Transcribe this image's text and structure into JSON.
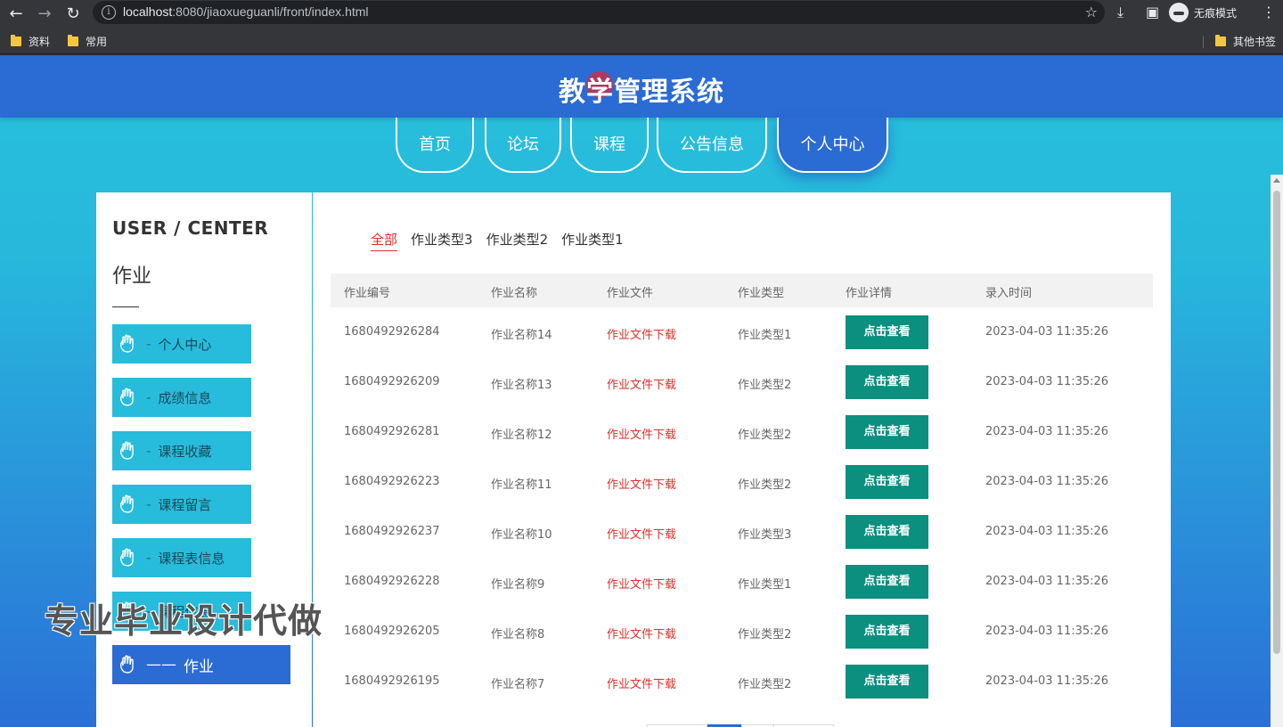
{
  "browser": {
    "url_host": "localhost",
    "url_rest": ":8080/jiaoxueguanli/front/index.html",
    "incognito_label": "无痕模式",
    "bookmarks": [
      "资料",
      "常用"
    ],
    "other_bookmarks": "其他书签"
  },
  "header": {
    "title": "教学管理系统"
  },
  "nav": [
    {
      "label": "首页"
    },
    {
      "label": "论坛"
    },
    {
      "label": "课程"
    },
    {
      "label": "公告信息"
    },
    {
      "label": "个人中心"
    }
  ],
  "sidebar": {
    "title": "USER / CENTER",
    "subtitle": "作业",
    "items": [
      {
        "label": "个人中心"
      },
      {
        "label": "成绩信息"
      },
      {
        "label": "课程收藏"
      },
      {
        "label": "课程留言"
      },
      {
        "label": "课程表信息"
      },
      {
        "label": "课程信息"
      },
      {
        "label": "作业"
      }
    ],
    "active_dash": "——",
    "dash": "-"
  },
  "watermark": "专业毕业设计代做",
  "tabs": [
    "全部",
    "作业类型3",
    "作业类型2",
    "作业类型1"
  ],
  "table": {
    "headers": [
      "作业编号",
      "作业名称",
      "作业文件",
      "作业类型",
      "作业详情",
      "录入时间"
    ],
    "rows": [
      {
        "id": "1680492926284",
        "name": "作业名称14",
        "file": "作业文件下载",
        "type": "作业类型1",
        "btn": "点击查看",
        "time": "2023-04-03 11:35:26"
      },
      {
        "id": "1680492926209",
        "name": "作业名称13",
        "file": "作业文件下载",
        "type": "作业类型2",
        "btn": "点击查看",
        "time": "2023-04-03 11:35:26"
      },
      {
        "id": "1680492926281",
        "name": "作业名称12",
        "file": "作业文件下载",
        "type": "作业类型2",
        "btn": "点击查看",
        "time": "2023-04-03 11:35:26"
      },
      {
        "id": "1680492926223",
        "name": "作业名称11",
        "file": "作业文件下载",
        "type": "作业类型2",
        "btn": "点击查看",
        "time": "2023-04-03 11:35:26"
      },
      {
        "id": "1680492926237",
        "name": "作业名称10",
        "file": "作业文件下载",
        "type": "作业类型3",
        "btn": "点击查看",
        "time": "2023-04-03 11:35:26"
      },
      {
        "id": "1680492926228",
        "name": "作业名称9",
        "file": "作业文件下载",
        "type": "作业类型1",
        "btn": "点击查看",
        "time": "2023-04-03 11:35:26"
      },
      {
        "id": "1680492926205",
        "name": "作业名称8",
        "file": "作业文件下载",
        "type": "作业类型2",
        "btn": "点击查看",
        "time": "2023-04-03 11:35:26"
      },
      {
        "id": "1680492926195",
        "name": "作业名称7",
        "file": "作业文件下载",
        "type": "作业类型2",
        "btn": "点击查看",
        "time": "2023-04-03 11:35:26"
      }
    ]
  },
  "colors": {
    "primary": "#2b6bd4",
    "accent": "#27bcdb",
    "button": "#0b8f7f",
    "link": "#e0302a"
  }
}
